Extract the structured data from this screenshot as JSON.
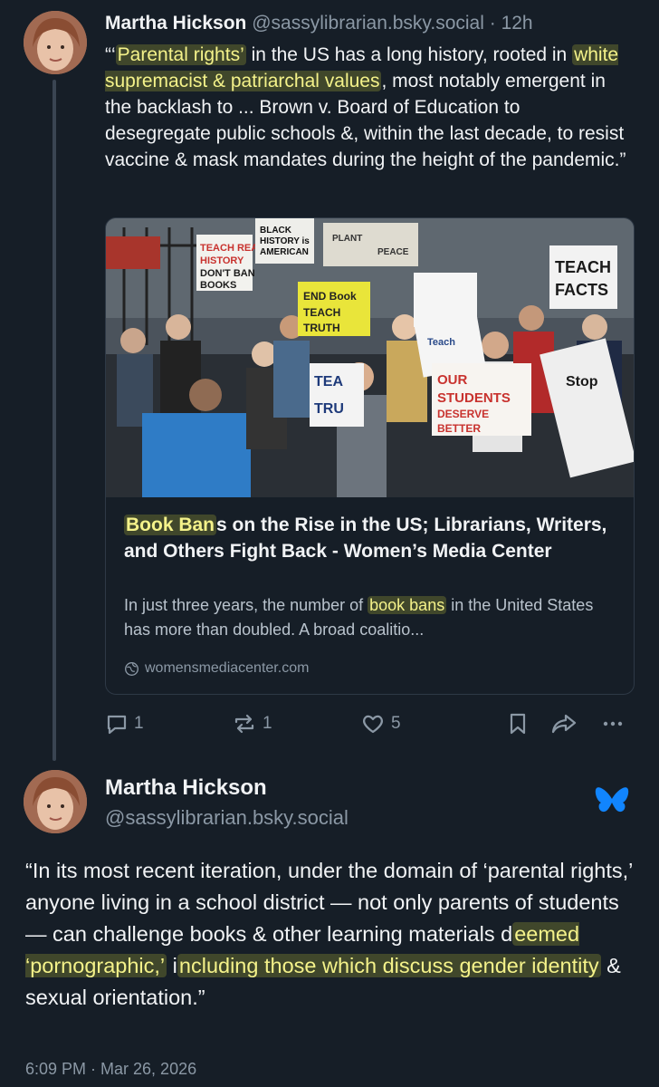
{
  "post1": {
    "author_name": "Martha Hickson",
    "handle": "@sassylibrarian.bsky.social",
    "time": "· 12h",
    "text": {
      "part1": "“‘",
      "highlight1": "Parental rights’",
      "part2": " in the US has a long history, rooted in ",
      "highlight2": "white supremacist & patriarchal values",
      "part3": ", most notably emergent in the backlash to ... Brown v. Board of Education to desegregate public schools &, within the last decade, to resist vaccine & mask mandates during the height of the pandemic.”"
    },
    "card": {
      "image_signs": [
        "TEACH REAL HISTORY DON'T BAN BOOKS",
        "BLACK HISTORY is AMERICAN HISTORY",
        "PLANT ... PEACE",
        "TEACH FACTS",
        "END Book BANS",
        "TEACH TRUTH",
        "TEACH TRU",
        "Teach Families",
        "OUR STUDENTS DESERVE BETTER",
        "Stop Censorship"
      ],
      "title_highlight": "Book Ban",
      "title_rest": "s on the Rise in the US; Librarians, Writers, and Others Fight Back - Women’s Media Center",
      "desc_part1": "In just three years, the number of ",
      "desc_highlight": "book bans",
      "desc_part2": " in the United States has more than doubled. A broad coalitio...",
      "domain": "womensmediacenter.com",
      "domain_icon": "globe-icon"
    },
    "actions": {
      "reply_count": "1",
      "repost_count": "1",
      "like_count": "5"
    }
  },
  "post2": {
    "author_name": "Martha Hickson",
    "handle": "@sassylibrarian.bsky.social",
    "text": {
      "part1": "“In its most recent iteration, under the domain of ‘parental rights,’ anyone living in a school district — not only parents of students — can challenge books & other learning materials d",
      "highlight1": "eemed ‘pornographic,’",
      "part2": " i",
      "highlight2": "ncluding those which discuss gender identity",
      "part3": " & sexual orientation.”"
    },
    "timestamp": "6:09 PM · Mar 26, 2026"
  },
  "colors": {
    "background": "#161e27",
    "text": "#f1f3f5",
    "muted": "#8b98a5",
    "highlight": "#f4f28a",
    "bluesky_blue": "#1185fe"
  }
}
